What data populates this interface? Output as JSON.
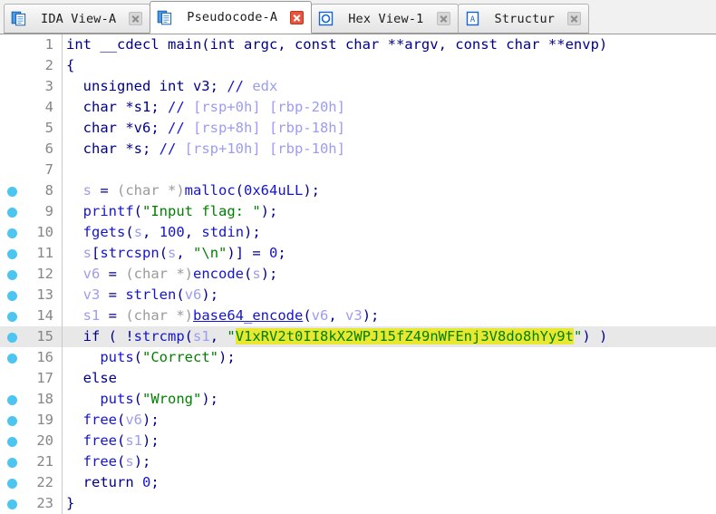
{
  "window": {
    "app": "IDA Pro",
    "view": "Pseudocode-A"
  },
  "tabbar": {
    "tabs": [
      {
        "label": "IDA View-A",
        "icon": "document-view-icon",
        "active": false,
        "close_icon": "close-icon",
        "close_style": "gray"
      },
      {
        "label": "Pseudocode-A",
        "icon": "document-view-icon",
        "active": true,
        "close_icon": "close-icon",
        "close_style": "red"
      },
      {
        "label": "Hex View-1",
        "icon": "hex-view-icon",
        "active": false,
        "close_icon": "close-icon",
        "close_style": "gray"
      },
      {
        "label": "Structur",
        "icon": "structures-icon",
        "active": false,
        "close_icon": "close-icon",
        "close_style": "gray"
      }
    ]
  },
  "colors": {
    "keyword": "#00008c",
    "function": "#1414d2",
    "variable": "#9c9cf0",
    "string": "#008000",
    "comment": "#9c9cf0",
    "cast": "#9a9a9a",
    "highlight": "#e8e832",
    "current_line": "#e8e8e8",
    "breakpoint": "#4cc6f0",
    "line_number": "#868686"
  },
  "code": {
    "highlighted_string": "V1xRV2t0II8kX2WPJ15fZ49nWFEnj3V8do8hYy9t",
    "current_line": 15,
    "lines": [
      {
        "n": "1",
        "bp": false,
        "cur": false,
        "tokens": [
          {
            "t": "int __cdecl main(int argc, const char **argv, const char **envp)",
            "c": "k"
          }
        ]
      },
      {
        "n": "2",
        "bp": false,
        "cur": false,
        "tokens": [
          {
            "t": "{",
            "c": "k"
          }
        ]
      },
      {
        "n": "3",
        "bp": false,
        "cur": false,
        "tokens": [
          {
            "t": "  unsigned int v3; ",
            "c": "k"
          },
          {
            "t": "// ",
            "c": "cm"
          },
          {
            "t": "edx",
            "c": "cmt"
          }
        ]
      },
      {
        "n": "4",
        "bp": false,
        "cur": false,
        "tokens": [
          {
            "t": "  char *s1; ",
            "c": "k"
          },
          {
            "t": "// ",
            "c": "cm"
          },
          {
            "t": "[rsp+0h] [rbp-20h]",
            "c": "cmt"
          }
        ]
      },
      {
        "n": "5",
        "bp": false,
        "cur": false,
        "tokens": [
          {
            "t": "  char *v6; ",
            "c": "k"
          },
          {
            "t": "// ",
            "c": "cm"
          },
          {
            "t": "[rsp+8h] [rbp-18h]",
            "c": "cmt"
          }
        ]
      },
      {
        "n": "6",
        "bp": false,
        "cur": false,
        "tokens": [
          {
            "t": "  char *s; ",
            "c": "k"
          },
          {
            "t": "// ",
            "c": "cm"
          },
          {
            "t": "[rsp+10h] [rbp-10h]",
            "c": "cmt"
          }
        ]
      },
      {
        "n": "7",
        "bp": false,
        "cur": false,
        "tokens": [
          {
            "t": "",
            "c": "k"
          }
        ]
      },
      {
        "n": "8",
        "bp": true,
        "cur": false,
        "tokens": [
          {
            "t": "  ",
            "c": "k"
          },
          {
            "t": "s",
            "c": "var"
          },
          {
            "t": " = ",
            "c": "k"
          },
          {
            "t": "(char *)",
            "c": "cast"
          },
          {
            "t": "malloc",
            "c": "fn"
          },
          {
            "t": "(",
            "c": "pun"
          },
          {
            "t": "0x64uLL",
            "c": "num"
          },
          {
            "t": ");",
            "c": "pun"
          }
        ]
      },
      {
        "n": "9",
        "bp": true,
        "cur": false,
        "tokens": [
          {
            "t": "  ",
            "c": "k"
          },
          {
            "t": "printf",
            "c": "fn"
          },
          {
            "t": "(",
            "c": "pun"
          },
          {
            "t": "\"Input flag: \"",
            "c": "str"
          },
          {
            "t": ");",
            "c": "pun"
          }
        ]
      },
      {
        "n": "10",
        "bp": true,
        "cur": false,
        "tokens": [
          {
            "t": "  ",
            "c": "k"
          },
          {
            "t": "fgets",
            "c": "fn"
          },
          {
            "t": "(",
            "c": "pun"
          },
          {
            "t": "s",
            "c": "var"
          },
          {
            "t": ", ",
            "c": "pun"
          },
          {
            "t": "100",
            "c": "num"
          },
          {
            "t": ", ",
            "c": "pun"
          },
          {
            "t": "stdin",
            "c": "fn"
          },
          {
            "t": ");",
            "c": "pun"
          }
        ]
      },
      {
        "n": "11",
        "bp": true,
        "cur": false,
        "tokens": [
          {
            "t": "  ",
            "c": "k"
          },
          {
            "t": "s",
            "c": "var"
          },
          {
            "t": "[",
            "c": "pun"
          },
          {
            "t": "strcspn",
            "c": "fn"
          },
          {
            "t": "(",
            "c": "pun"
          },
          {
            "t": "s",
            "c": "var"
          },
          {
            "t": ", ",
            "c": "pun"
          },
          {
            "t": "\"\\n\"",
            "c": "str"
          },
          {
            "t": ")] = ",
            "c": "pun"
          },
          {
            "t": "0",
            "c": "num"
          },
          {
            "t": ";",
            "c": "pun"
          }
        ]
      },
      {
        "n": "12",
        "bp": true,
        "cur": false,
        "tokens": [
          {
            "t": "  ",
            "c": "k"
          },
          {
            "t": "v6",
            "c": "var"
          },
          {
            "t": " = ",
            "c": "k"
          },
          {
            "t": "(char *)",
            "c": "cast"
          },
          {
            "t": "encode",
            "c": "fn"
          },
          {
            "t": "(",
            "c": "pun"
          },
          {
            "t": "s",
            "c": "var"
          },
          {
            "t": ");",
            "c": "pun"
          }
        ]
      },
      {
        "n": "13",
        "bp": true,
        "cur": false,
        "tokens": [
          {
            "t": "  ",
            "c": "k"
          },
          {
            "t": "v3",
            "c": "var"
          },
          {
            "t": " = ",
            "c": "k"
          },
          {
            "t": "strlen",
            "c": "fn"
          },
          {
            "t": "(",
            "c": "pun"
          },
          {
            "t": "v6",
            "c": "var"
          },
          {
            "t": ");",
            "c": "pun"
          }
        ]
      },
      {
        "n": "14",
        "bp": true,
        "cur": false,
        "tokens": [
          {
            "t": "  ",
            "c": "k"
          },
          {
            "t": "s1",
            "c": "var"
          },
          {
            "t": " = ",
            "c": "k"
          },
          {
            "t": "(char *)",
            "c": "cast"
          },
          {
            "t": "base64_encode",
            "c": "fnu"
          },
          {
            "t": "(",
            "c": "pun"
          },
          {
            "t": "v6",
            "c": "var"
          },
          {
            "t": ", ",
            "c": "pun"
          },
          {
            "t": "v3",
            "c": "var"
          },
          {
            "t": ");",
            "c": "pun"
          }
        ]
      },
      {
        "n": "15",
        "bp": true,
        "cur": true,
        "tokens": [
          {
            "t": "  ",
            "c": "k"
          },
          {
            "t": "if ( !",
            "c": "k"
          },
          {
            "t": "strcmp",
            "c": "fn"
          },
          {
            "t": "(",
            "c": "pun"
          },
          {
            "t": "s1",
            "c": "var"
          },
          {
            "t": ", ",
            "c": "pun"
          },
          {
            "t": "\"",
            "c": "str"
          },
          {
            "t": "V1xRV2t0II8kX2WPJ15fZ49nWFEnj3V8do8hYy9t",
            "c": "str hl"
          },
          {
            "t": "\"",
            "c": "str"
          },
          {
            "t": ") )",
            "c": "pun"
          }
        ]
      },
      {
        "n": "16",
        "bp": true,
        "cur": false,
        "tokens": [
          {
            "t": "    ",
            "c": "k"
          },
          {
            "t": "puts",
            "c": "fn"
          },
          {
            "t": "(",
            "c": "pun"
          },
          {
            "t": "\"Correct\"",
            "c": "str"
          },
          {
            "t": ");",
            "c": "pun"
          }
        ]
      },
      {
        "n": "17",
        "bp": false,
        "cur": false,
        "tokens": [
          {
            "t": "  else",
            "c": "k"
          }
        ]
      },
      {
        "n": "18",
        "bp": true,
        "cur": false,
        "tokens": [
          {
            "t": "    ",
            "c": "k"
          },
          {
            "t": "puts",
            "c": "fn"
          },
          {
            "t": "(",
            "c": "pun"
          },
          {
            "t": "\"Wrong\"",
            "c": "str"
          },
          {
            "t": ");",
            "c": "pun"
          }
        ]
      },
      {
        "n": "19",
        "bp": true,
        "cur": false,
        "tokens": [
          {
            "t": "  ",
            "c": "k"
          },
          {
            "t": "free",
            "c": "fn"
          },
          {
            "t": "(",
            "c": "pun"
          },
          {
            "t": "v6",
            "c": "var"
          },
          {
            "t": ");",
            "c": "pun"
          }
        ]
      },
      {
        "n": "20",
        "bp": true,
        "cur": false,
        "tokens": [
          {
            "t": "  ",
            "c": "k"
          },
          {
            "t": "free",
            "c": "fn"
          },
          {
            "t": "(",
            "c": "pun"
          },
          {
            "t": "s1",
            "c": "var"
          },
          {
            "t": ");",
            "c": "pun"
          }
        ]
      },
      {
        "n": "21",
        "bp": true,
        "cur": false,
        "tokens": [
          {
            "t": "  ",
            "c": "k"
          },
          {
            "t": "free",
            "c": "fn"
          },
          {
            "t": "(",
            "c": "pun"
          },
          {
            "t": "s",
            "c": "var"
          },
          {
            "t": ");",
            "c": "pun"
          }
        ]
      },
      {
        "n": "22",
        "bp": true,
        "cur": false,
        "tokens": [
          {
            "t": "  return ",
            "c": "k"
          },
          {
            "t": "0",
            "c": "num"
          },
          {
            "t": ";",
            "c": "pun"
          }
        ]
      },
      {
        "n": "23",
        "bp": true,
        "cur": false,
        "tokens": [
          {
            "t": "}",
            "c": "k"
          }
        ]
      }
    ]
  }
}
